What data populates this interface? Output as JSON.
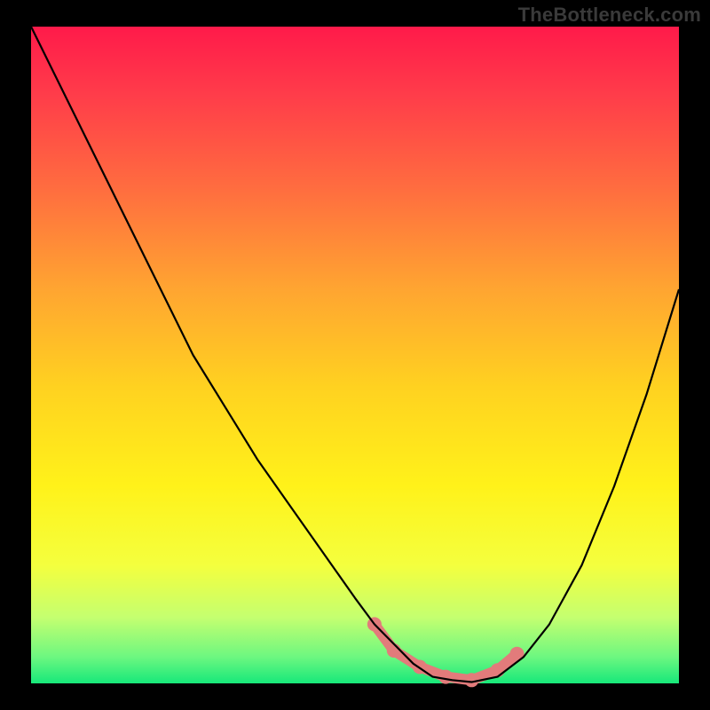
{
  "watermark": "TheBottleneck.com",
  "chart_data": {
    "type": "line",
    "title": "",
    "xlabel": "",
    "ylabel": "",
    "xlim": [
      0,
      100
    ],
    "ylim": [
      0,
      100
    ],
    "legend": false,
    "grid": false,
    "background": {
      "type": "vertical-gradient",
      "stops": [
        {
          "offset": 0.0,
          "color": "#ff1a4a"
        },
        {
          "offset": 0.1,
          "color": "#ff3b4a"
        },
        {
          "offset": 0.25,
          "color": "#ff6e3f"
        },
        {
          "offset": 0.4,
          "color": "#ffa531"
        },
        {
          "offset": 0.55,
          "color": "#ffd220"
        },
        {
          "offset": 0.7,
          "color": "#fff21a"
        },
        {
          "offset": 0.82,
          "color": "#f4ff3e"
        },
        {
          "offset": 0.9,
          "color": "#c4ff70"
        },
        {
          "offset": 0.96,
          "color": "#6cf780"
        },
        {
          "offset": 1.0,
          "color": "#17e87a"
        }
      ]
    },
    "series": [
      {
        "name": "bottleneck-curve",
        "stroke": "#000000",
        "x": [
          0,
          5,
          10,
          15,
          20,
          25,
          30,
          35,
          40,
          45,
          50,
          53,
          56,
          59,
          62,
          65,
          68,
          72,
          76,
          80,
          85,
          90,
          95,
          100
        ],
        "values": [
          100,
          90,
          80,
          70,
          60,
          50,
          42,
          34,
          27,
          20,
          13,
          9,
          6,
          3,
          1,
          0.5,
          0.2,
          1,
          4,
          9,
          18,
          30,
          44,
          60
        ]
      }
    ],
    "highlight": {
      "name": "optimal-band",
      "color": "#e27b7b",
      "x_range": [
        53,
        75
      ],
      "y_range": [
        0,
        4
      ],
      "dots": [
        {
          "x": 53,
          "y": 9
        },
        {
          "x": 56,
          "y": 5
        },
        {
          "x": 60,
          "y": 2.5
        },
        {
          "x": 64,
          "y": 1
        },
        {
          "x": 68,
          "y": 0.5
        },
        {
          "x": 72,
          "y": 2
        },
        {
          "x": 75,
          "y": 4.5
        }
      ]
    }
  }
}
